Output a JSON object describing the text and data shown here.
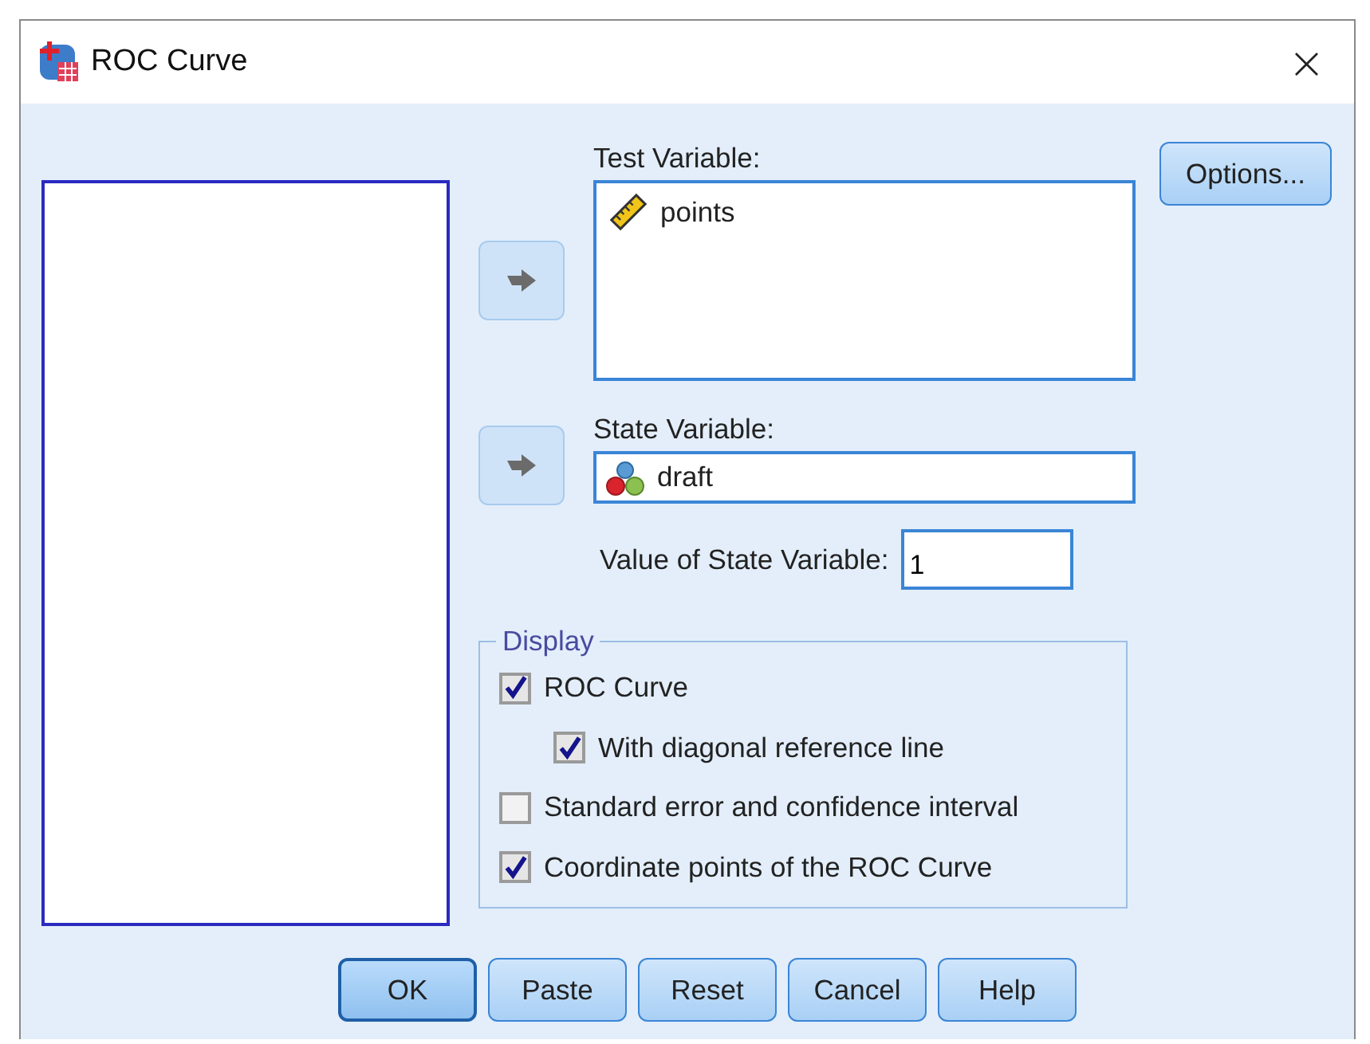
{
  "window": {
    "title": "ROC Curve",
    "close": "×"
  },
  "test_variable": {
    "label": "Test Variable:",
    "items": [
      {
        "name": "points",
        "kind": "scale"
      }
    ]
  },
  "state_variable": {
    "label": "State Variable:",
    "value": "draft",
    "kind": "nominal"
  },
  "value_of_state": {
    "label": "Value of State Variable:",
    "value": "1"
  },
  "options_button": "Options...",
  "display": {
    "title": "Display",
    "options": [
      {
        "label": "ROC Curve",
        "checked": true,
        "children": [
          {
            "label": "With diagonal reference line",
            "checked": true
          }
        ]
      },
      {
        "label": "Standard error and confidence interval",
        "checked": false
      },
      {
        "label": "Coordinate points of the ROC Curve",
        "checked": true
      }
    ]
  },
  "buttons": [
    {
      "label": "OK",
      "default": true
    },
    {
      "label": "Paste",
      "default": false
    },
    {
      "label": "Reset",
      "default": false
    },
    {
      "label": "Cancel",
      "default": false
    },
    {
      "label": "Help",
      "default": false
    }
  ]
}
